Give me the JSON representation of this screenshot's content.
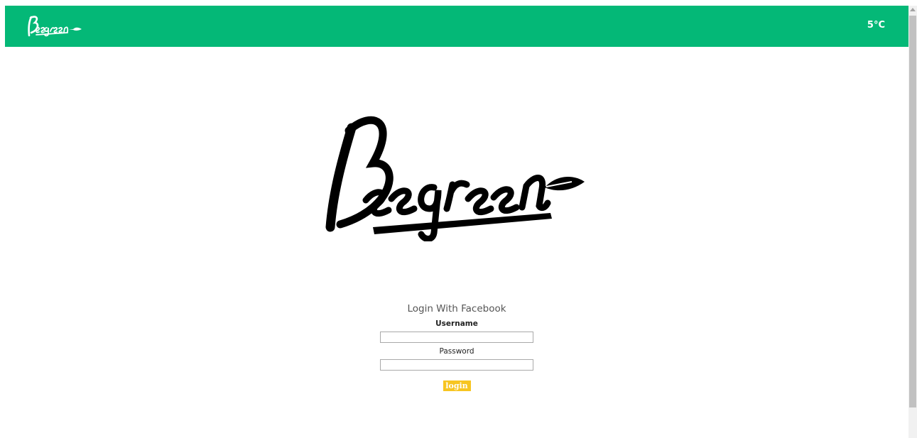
{
  "header": {
    "brand_logo": "Beegreen",
    "temperature": "5°C",
    "background_color": "#04b877"
  },
  "main": {
    "brand_logo": "Beegreen"
  },
  "login": {
    "heading": "Login With Facebook",
    "username_label": "Username",
    "username_value": "",
    "password_label": "Password",
    "password_value": "",
    "submit_label": "login",
    "button_color": "#f7c521"
  }
}
